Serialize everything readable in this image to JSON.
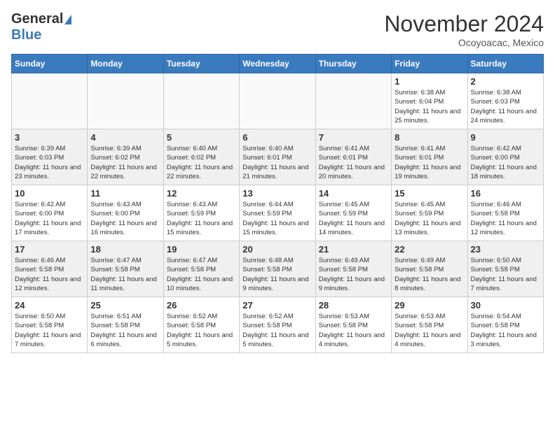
{
  "header": {
    "logo_general": "General",
    "logo_blue": "Blue",
    "title": "November 2024",
    "location": "Ocoyoacac, Mexico"
  },
  "weekdays": [
    "Sunday",
    "Monday",
    "Tuesday",
    "Wednesday",
    "Thursday",
    "Friday",
    "Saturday"
  ],
  "weeks": [
    [
      {
        "day": "",
        "info": "",
        "empty": true
      },
      {
        "day": "",
        "info": "",
        "empty": true
      },
      {
        "day": "",
        "info": "",
        "empty": true
      },
      {
        "day": "",
        "info": "",
        "empty": true
      },
      {
        "day": "",
        "info": "",
        "empty": true
      },
      {
        "day": "1",
        "info": "Sunrise: 6:38 AM\nSunset: 6:04 PM\nDaylight: 11 hours and 25 minutes."
      },
      {
        "day": "2",
        "info": "Sunrise: 6:38 AM\nSunset: 6:03 PM\nDaylight: 11 hours and 24 minutes."
      }
    ],
    [
      {
        "day": "3",
        "info": "Sunrise: 6:39 AM\nSunset: 6:03 PM\nDaylight: 11 hours and 23 minutes."
      },
      {
        "day": "4",
        "info": "Sunrise: 6:39 AM\nSunset: 6:02 PM\nDaylight: 11 hours and 22 minutes."
      },
      {
        "day": "5",
        "info": "Sunrise: 6:40 AM\nSunset: 6:02 PM\nDaylight: 11 hours and 22 minutes."
      },
      {
        "day": "6",
        "info": "Sunrise: 6:40 AM\nSunset: 6:01 PM\nDaylight: 11 hours and 21 minutes."
      },
      {
        "day": "7",
        "info": "Sunrise: 6:41 AM\nSunset: 6:01 PM\nDaylight: 11 hours and 20 minutes."
      },
      {
        "day": "8",
        "info": "Sunrise: 6:41 AM\nSunset: 6:01 PM\nDaylight: 11 hours and 19 minutes."
      },
      {
        "day": "9",
        "info": "Sunrise: 6:42 AM\nSunset: 6:00 PM\nDaylight: 11 hours and 18 minutes."
      }
    ],
    [
      {
        "day": "10",
        "info": "Sunrise: 6:42 AM\nSunset: 6:00 PM\nDaylight: 11 hours and 17 minutes."
      },
      {
        "day": "11",
        "info": "Sunrise: 6:43 AM\nSunset: 6:00 PM\nDaylight: 11 hours and 16 minutes."
      },
      {
        "day": "12",
        "info": "Sunrise: 6:43 AM\nSunset: 5:59 PM\nDaylight: 11 hours and 15 minutes."
      },
      {
        "day": "13",
        "info": "Sunrise: 6:44 AM\nSunset: 5:59 PM\nDaylight: 11 hours and 15 minutes."
      },
      {
        "day": "14",
        "info": "Sunrise: 6:45 AM\nSunset: 5:59 PM\nDaylight: 11 hours and 14 minutes."
      },
      {
        "day": "15",
        "info": "Sunrise: 6:45 AM\nSunset: 5:59 PM\nDaylight: 11 hours and 13 minutes."
      },
      {
        "day": "16",
        "info": "Sunrise: 6:46 AM\nSunset: 5:58 PM\nDaylight: 11 hours and 12 minutes."
      }
    ],
    [
      {
        "day": "17",
        "info": "Sunrise: 6:46 AM\nSunset: 5:58 PM\nDaylight: 11 hours and 12 minutes."
      },
      {
        "day": "18",
        "info": "Sunrise: 6:47 AM\nSunset: 5:58 PM\nDaylight: 11 hours and 11 minutes."
      },
      {
        "day": "19",
        "info": "Sunrise: 6:47 AM\nSunset: 5:58 PM\nDaylight: 11 hours and 10 minutes."
      },
      {
        "day": "20",
        "info": "Sunrise: 6:48 AM\nSunset: 5:58 PM\nDaylight: 11 hours and 9 minutes."
      },
      {
        "day": "21",
        "info": "Sunrise: 6:49 AM\nSunset: 5:58 PM\nDaylight: 11 hours and 9 minutes."
      },
      {
        "day": "22",
        "info": "Sunrise: 6:49 AM\nSunset: 5:58 PM\nDaylight: 11 hours and 8 minutes."
      },
      {
        "day": "23",
        "info": "Sunrise: 6:50 AM\nSunset: 5:58 PM\nDaylight: 11 hours and 7 minutes."
      }
    ],
    [
      {
        "day": "24",
        "info": "Sunrise: 6:50 AM\nSunset: 5:58 PM\nDaylight: 11 hours and 7 minutes."
      },
      {
        "day": "25",
        "info": "Sunrise: 6:51 AM\nSunset: 5:58 PM\nDaylight: 11 hours and 6 minutes."
      },
      {
        "day": "26",
        "info": "Sunrise: 6:52 AM\nSunset: 5:58 PM\nDaylight: 11 hours and 5 minutes."
      },
      {
        "day": "27",
        "info": "Sunrise: 6:52 AM\nSunset: 5:58 PM\nDaylight: 11 hours and 5 minutes."
      },
      {
        "day": "28",
        "info": "Sunrise: 6:53 AM\nSunset: 5:58 PM\nDaylight: 11 hours and 4 minutes."
      },
      {
        "day": "29",
        "info": "Sunrise: 6:53 AM\nSunset: 5:58 PM\nDaylight: 11 hours and 4 minutes."
      },
      {
        "day": "30",
        "info": "Sunrise: 6:54 AM\nSunset: 5:58 PM\nDaylight: 11 hours and 3 minutes."
      }
    ]
  ]
}
